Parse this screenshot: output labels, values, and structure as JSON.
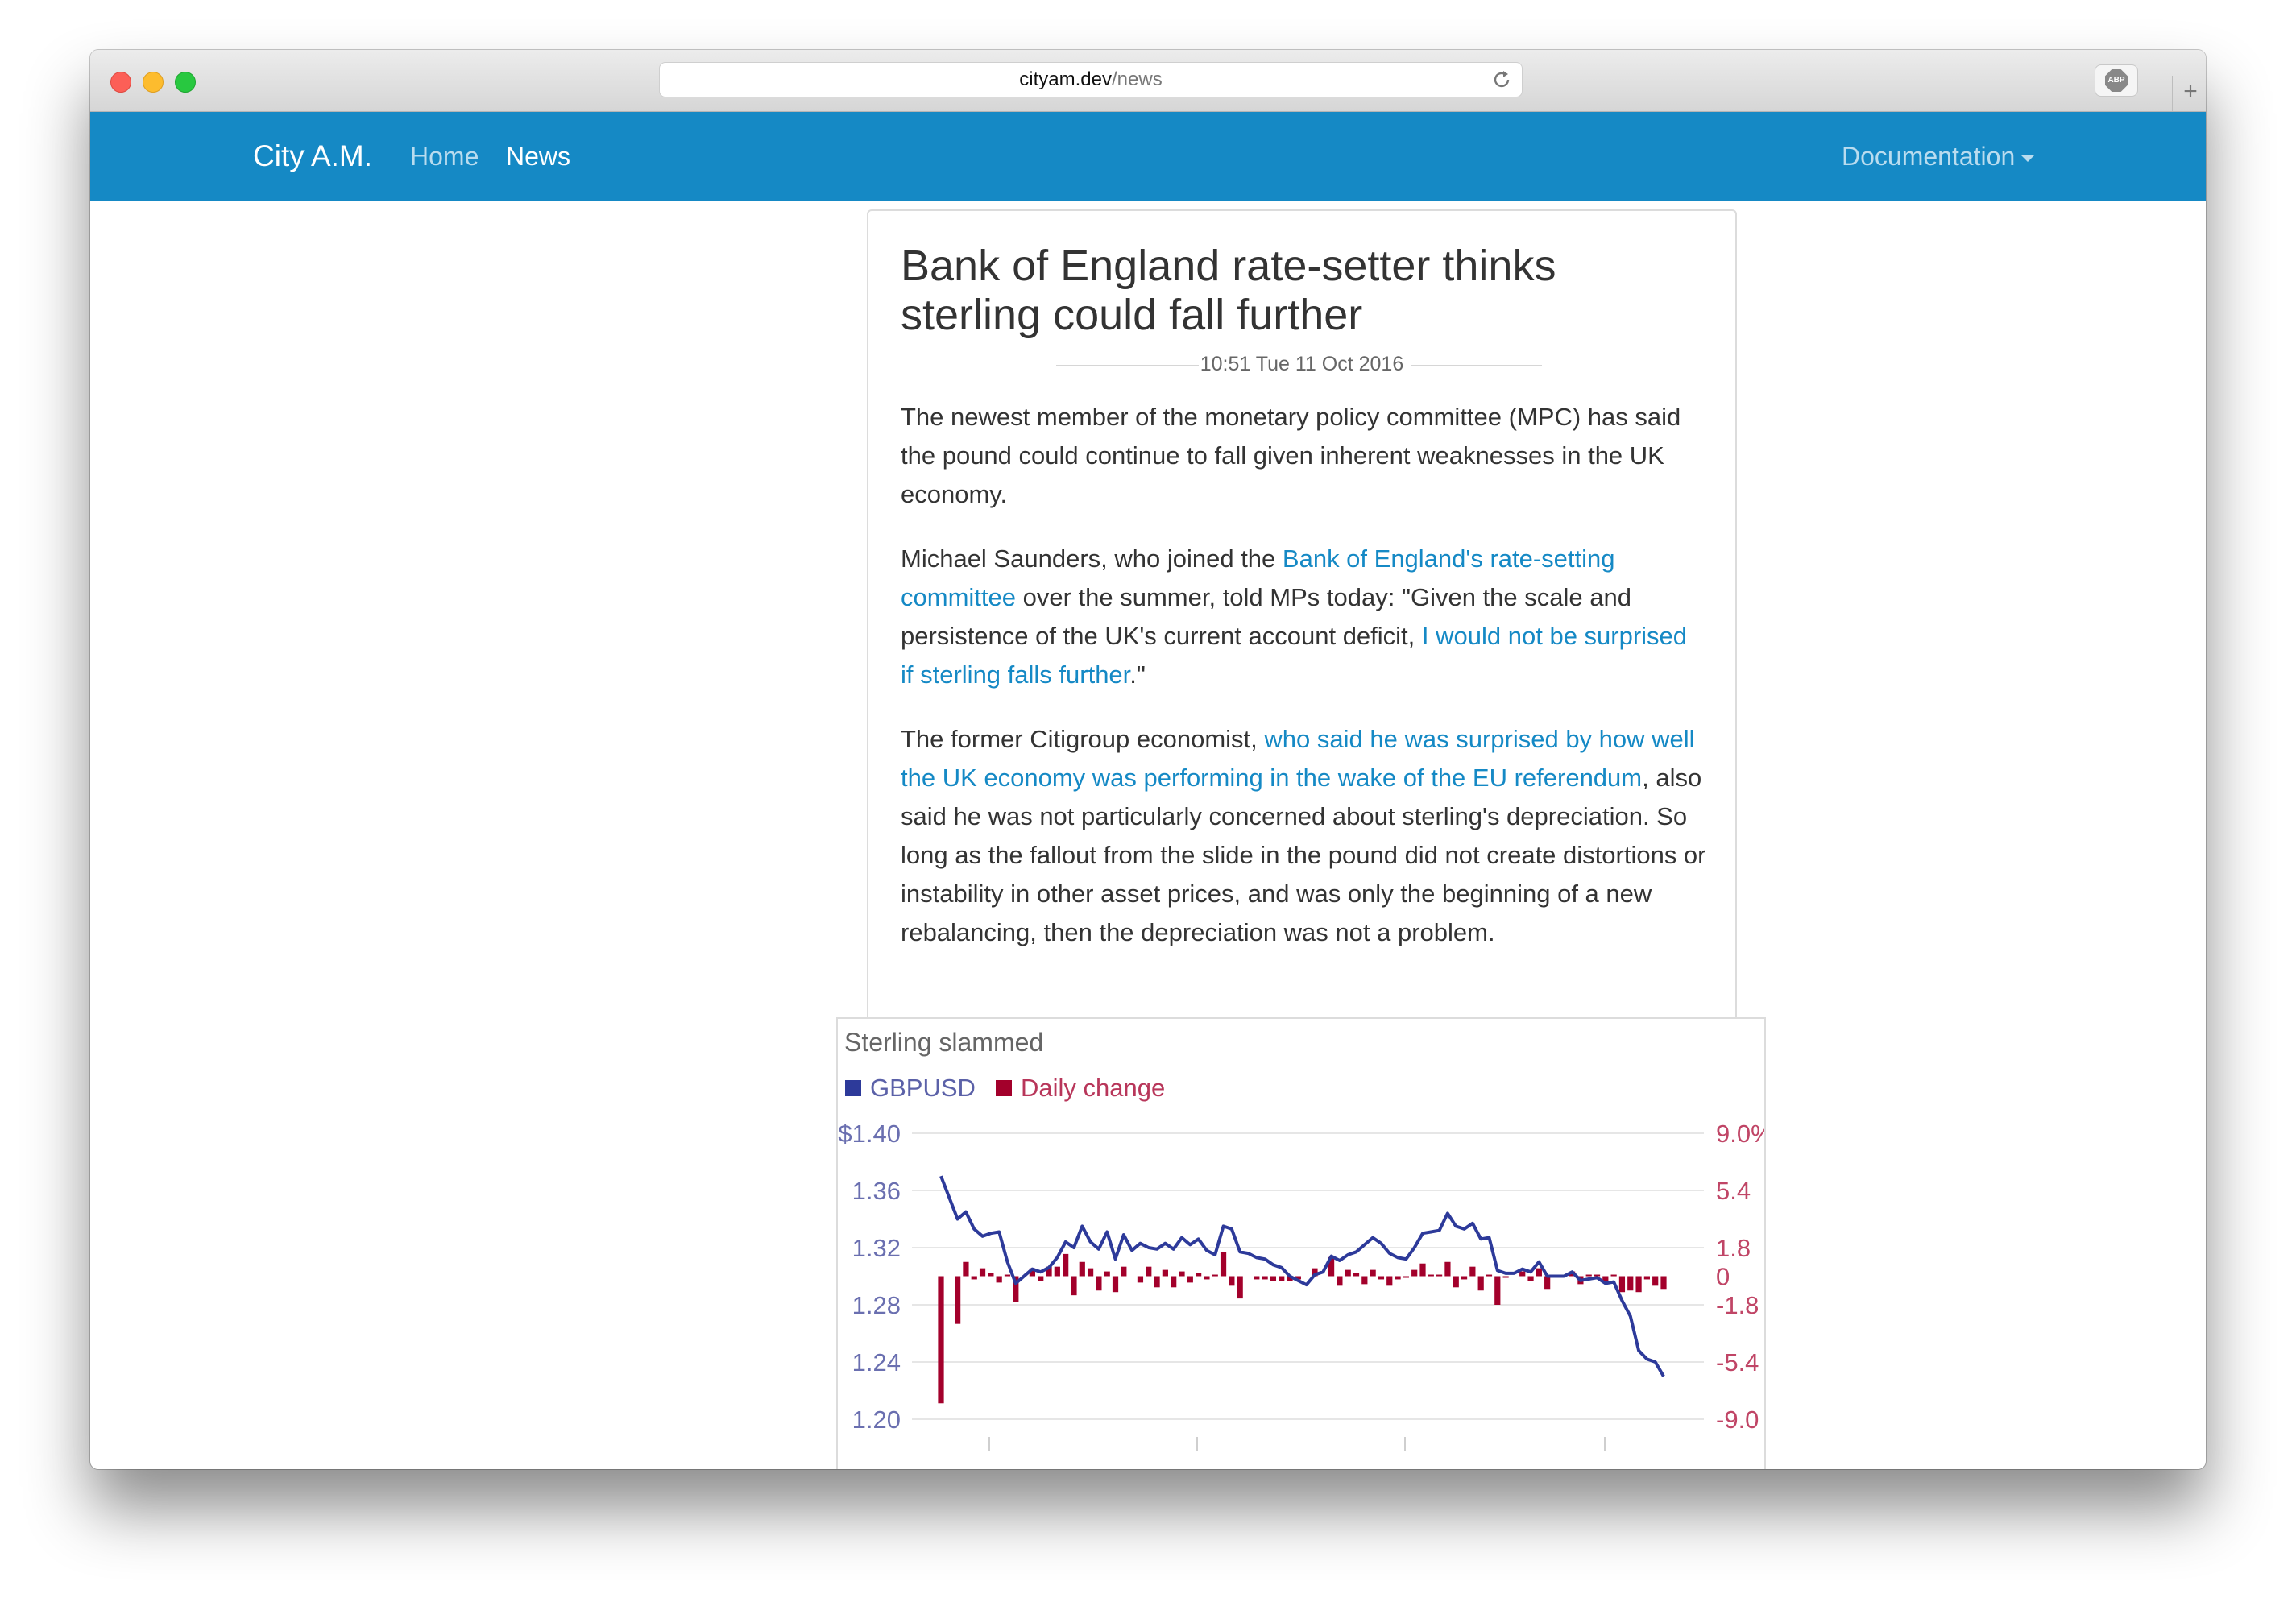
{
  "browser": {
    "url_host": "cityam.dev",
    "url_path": "/news",
    "extension_label": "ABP",
    "new_tab_label": "+"
  },
  "nav": {
    "brand": "City A.M.",
    "home": "Home",
    "news": "News",
    "documentation": "Documentation"
  },
  "article": {
    "title": "Bank of England rate-setter thinks sterling could fall further",
    "timestamp": "10:51 Tue 11 Oct 2016",
    "p1": "The newest member of the monetary policy committee (MPC) has said the pound could continue to fall given inherent weaknesses in the UK economy.",
    "p2_a": "Michael Saunders, who joined the ",
    "p2_link1": "Bank of England's rate-setting committee",
    "p2_b": " over the summer, told MPs today: \"Given the scale and persistence of the UK's current account deficit, ",
    "p2_link2": "I would not be surprised if sterling falls further",
    "p2_c": ".\"",
    "p3_a": "The former Citigroup economist, ",
    "p3_link": "who said he was surprised by how well the UK economy was performing in the wake of the EU referendum",
    "p3_b": ", also said he was not particularly concerned about sterling's depreciation. So long as the fallout from the slide in the pound did not create distortions or instability in other asset prices, and was only the beginning of a new rebalancing, then the depreciation was not a problem."
  },
  "colors": {
    "navbar": "#1589c5",
    "link": "#1589c5",
    "gbpusd_series": "#2d3a9a",
    "daily_change_series": "#a3002b"
  },
  "chart_data": {
    "type": "line",
    "title": "Sterling slammed",
    "legend_position": "top-left",
    "grid": true,
    "series": [
      {
        "name": "GBPUSD",
        "axis": "left",
        "values": [
          1.37,
          1.355,
          1.34,
          1.345,
          1.333,
          1.328,
          1.33,
          1.331,
          1.31,
          1.295,
          1.3,
          1.305,
          1.303,
          1.306,
          1.313,
          1.324,
          1.32,
          1.335,
          1.324,
          1.319,
          1.331,
          1.312,
          1.329,
          1.318,
          1.323,
          1.32,
          1.319,
          1.323,
          1.319,
          1.327,
          1.322,
          1.326,
          1.318,
          1.315,
          1.335,
          1.333,
          1.317,
          1.316,
          1.313,
          1.312,
          1.308,
          1.306,
          1.3,
          1.297,
          1.294,
          1.301,
          1.303,
          1.314,
          1.311,
          1.315,
          1.317,
          1.322,
          1.327,
          1.323,
          1.316,
          1.313,
          1.312,
          1.32,
          1.33,
          1.331,
          1.332,
          1.344,
          1.335,
          1.333,
          1.337,
          1.326,
          1.327,
          1.304,
          1.302,
          1.302,
          1.305,
          1.303,
          1.31,
          1.3,
          1.3,
          1.3,
          1.303,
          1.297,
          1.298,
          1.299,
          1.295,
          1.296,
          1.283,
          1.272,
          1.248,
          1.242,
          1.24,
          1.23
        ],
        "axis_ticks": [
          "$1.40",
          "1.36",
          "1.32",
          "1.28",
          "1.24",
          "1.20"
        ],
        "ylim": [
          1.2,
          1.4
        ]
      },
      {
        "name": "Daily change",
        "axis": "right",
        "values": [
          -8.0,
          0,
          -3.0,
          0.9,
          -0.2,
          0.5,
          0.2,
          -0.4,
          0.1,
          -1.6,
          0,
          0.5,
          -0.3,
          0.6,
          0.6,
          1.4,
          -1.2,
          0.9,
          0.5,
          -0.9,
          0.3,
          -1.0,
          0.6,
          0,
          -0.4,
          0.6,
          -0.7,
          0.4,
          -0.7,
          0.3,
          -0.4,
          0.2,
          -0.2,
          0.1,
          1.5,
          -0.6,
          -1.4,
          0,
          -0.2,
          -0.2,
          -0.3,
          -0.3,
          -0.3,
          -0.2,
          0,
          0.5,
          0,
          1.2,
          -0.6,
          0.4,
          0.2,
          -0.5,
          0.4,
          -0.2,
          -0.6,
          -0.2,
          -0.1,
          0.4,
          0.8,
          0.1,
          0.1,
          0.9,
          -0.7,
          -0.2,
          0.6,
          -0.9,
          0.1,
          -1.8,
          -0.1,
          0,
          0.3,
          -0.3,
          0.5,
          -0.8,
          0,
          0,
          0.3,
          -0.5,
          0.1,
          0.1,
          -0.4,
          0.1,
          -1.0,
          -0.9,
          -1.0,
          -0.2,
          -0.6,
          -0.8
        ],
        "axis_ticks": [
          "9.0%",
          "5.4",
          "1.8",
          "0",
          "-1.8",
          "-5.4",
          "-9.0"
        ],
        "ylim": [
          -9.0,
          9.0
        ]
      }
    ]
  }
}
